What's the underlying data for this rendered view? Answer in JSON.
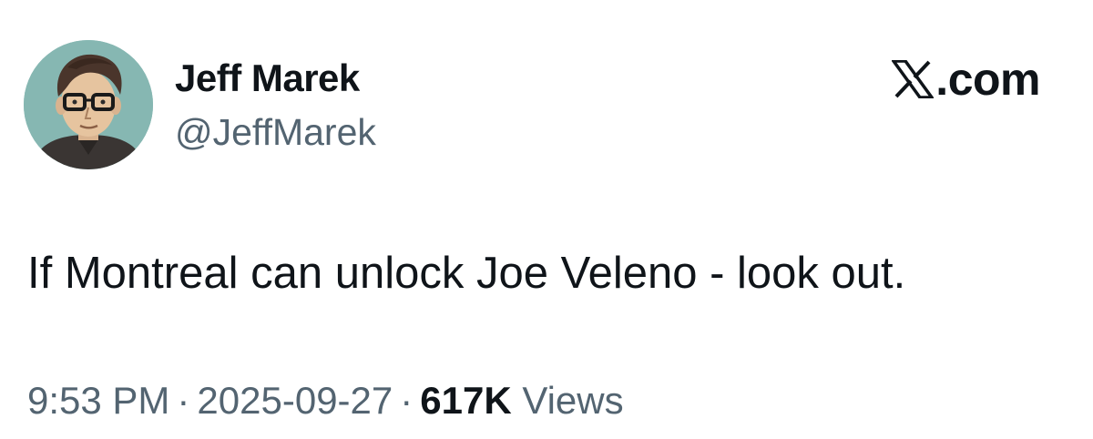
{
  "author": {
    "display_name": "Jeff Marek",
    "handle": "@JeffMarek",
    "avatar_icon": "cartoon-portrait-avatar"
  },
  "brand": {
    "label": ".com",
    "icon": "x-logo-icon"
  },
  "tweet": {
    "text": "If Montreal can unlock Joe Veleno - look out."
  },
  "meta": {
    "time": "9:53 PM",
    "separator": "·",
    "date": "2025-09-27",
    "views_count": "617K",
    "views_label": "Views"
  },
  "colors": {
    "text_primary": "#0f1419",
    "text_secondary": "#536471",
    "avatar_background": "#86b7b2"
  }
}
